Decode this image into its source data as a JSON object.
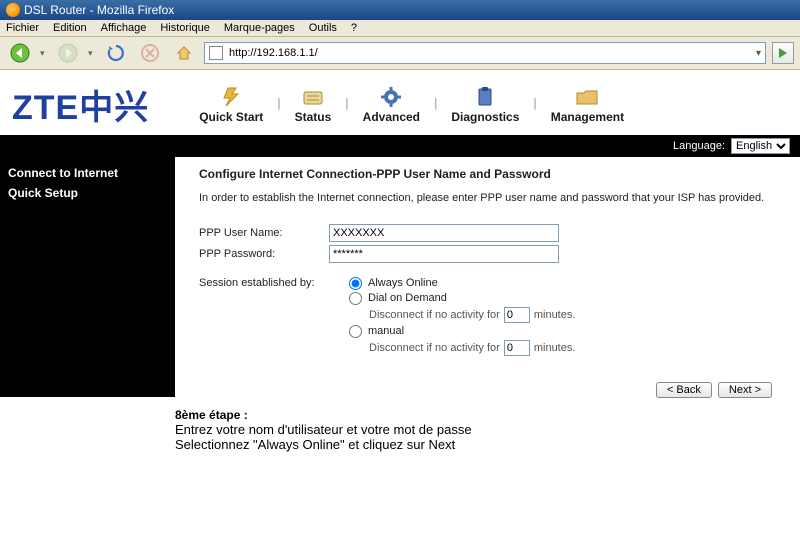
{
  "window": {
    "title": "DSL Router - Mozilla Firefox"
  },
  "menu": {
    "items": [
      "Fichier",
      "Edition",
      "Affichage",
      "Historique",
      "Marque-pages",
      "Outils",
      "?"
    ]
  },
  "url": "http://192.168.1.1/",
  "brand": "ZTE中兴",
  "tabs": {
    "quick_start": "Quick Start",
    "status": "Status",
    "advanced": "Advanced",
    "diagnostics": "Diagnostics",
    "management": "Management"
  },
  "language": {
    "label": "Language:",
    "selected": "English"
  },
  "sidebar": {
    "items": [
      "Connect to Internet",
      "Quick Setup"
    ]
  },
  "main": {
    "heading": "Configure Internet Connection-PPP User Name and Password",
    "intro": "In order to establish the Internet connection, please enter PPP user name and password that your ISP has provided.",
    "ppp_user_label": "PPP User Name:",
    "ppp_user_value": "XXXXXXX",
    "ppp_pass_label": "PPP Password:",
    "ppp_pass_value": "*******",
    "session_label": "Session established by:",
    "options": {
      "always": "Always Online",
      "dial": "Dial on Demand",
      "manual": "manual"
    },
    "disconnect_prefix": "Disconnect if no activity for",
    "disconnect_value": "0",
    "disconnect_suffix": "minutes.",
    "back": "< Back",
    "next": "Next >"
  },
  "footnote": {
    "step": "8ème étape :",
    "line1": "Entrez votre nom d'utilisateur et votre mot de passe",
    "line2": "Selectionnez \"Always Online\" et cliquez sur Next"
  }
}
